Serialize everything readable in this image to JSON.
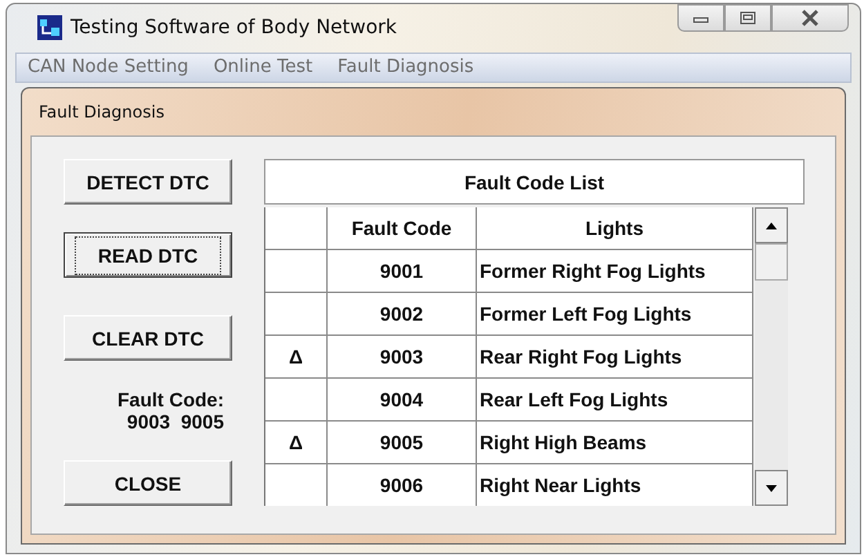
{
  "window": {
    "title": "Testing Software of Body Network"
  },
  "menu": [
    {
      "label": "CAN Node Setting"
    },
    {
      "label": "Online Test"
    },
    {
      "label": "Fault Diagnosis"
    }
  ],
  "child_window": {
    "title": "Fault Diagnosis"
  },
  "buttons": [
    {
      "label": "DETECT DTC",
      "focused": false
    },
    {
      "label": "READ DTC",
      "focused": true
    },
    {
      "label": "CLEAR DTC",
      "focused": false
    },
    {
      "label": "CLOSE",
      "focused": false
    }
  ],
  "fault_summary": {
    "label": "Fault Code:",
    "codes": "9003  9005"
  },
  "table": {
    "title": "Fault Code List",
    "columns": [
      "Fault Code",
      "Lights"
    ],
    "rows": [
      {
        "marker": "",
        "code": "9001",
        "light": "Former Right Fog Lights"
      },
      {
        "marker": "",
        "code": "9002",
        "light": "Former Left Fog Lights"
      },
      {
        "marker": "Δ",
        "code": "9003",
        "light": "Rear Right Fog Lights"
      },
      {
        "marker": "",
        "code": "9004",
        "light": "Rear Left Fog Lights"
      },
      {
        "marker": "Δ",
        "code": "9005",
        "light": "Right High Beams"
      },
      {
        "marker": "",
        "code": "9006",
        "light": "Right Near Lights"
      }
    ]
  }
}
